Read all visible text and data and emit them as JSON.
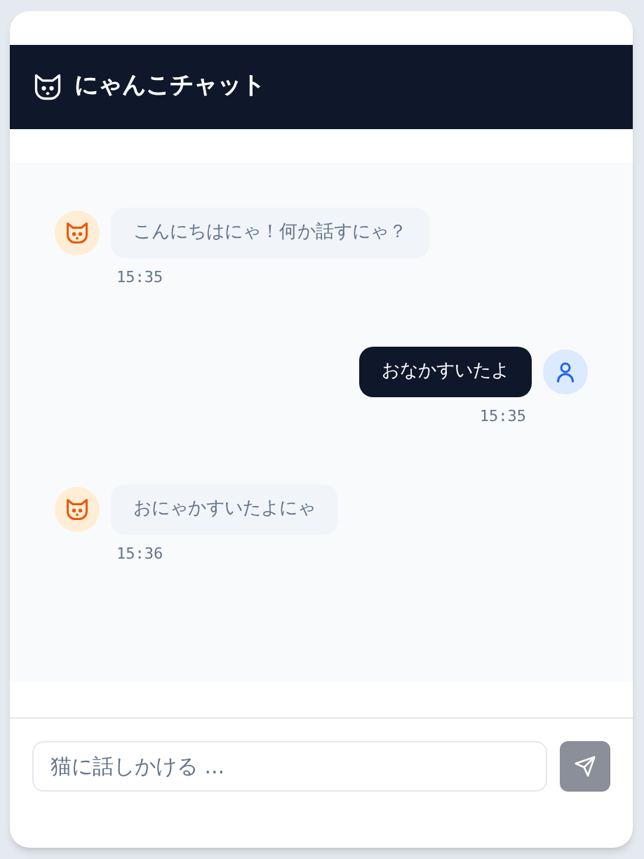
{
  "header": {
    "title": "にゃんこチャット"
  },
  "messages": [
    {
      "kind": "cat",
      "text": "こんにちはにゃ！何か話すにゃ？",
      "time": "15:35"
    },
    {
      "kind": "user",
      "text": "おなかすいたよ",
      "time": "15:35"
    },
    {
      "kind": "cat",
      "text": "おにゃかすいたよにゃ",
      "time": "15:36"
    }
  ],
  "input": {
    "placeholder": "猫に話しかける ...",
    "send_disabled": true
  }
}
